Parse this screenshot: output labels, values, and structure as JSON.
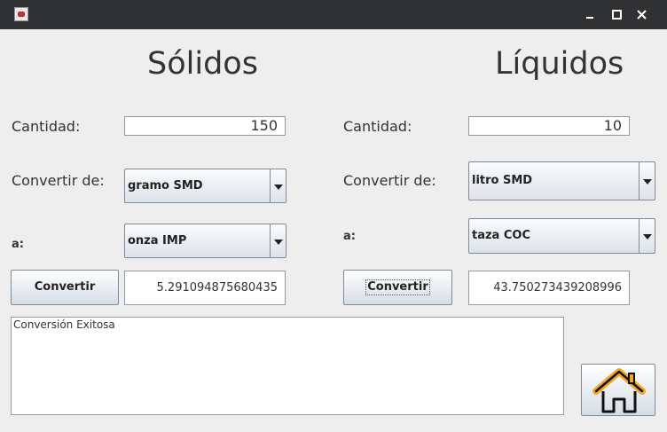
{
  "solidos": {
    "title": "Sólidos",
    "cantidad_label": "Cantidad:",
    "cantidad_value": "150",
    "de_label": "Convertir de:",
    "de_value": "gramo SMD",
    "a_label": "a:",
    "a_value": "onza IMP",
    "button_label": "Convertir",
    "result": "5.291094875680435"
  },
  "liquidos": {
    "title": "Líquidos",
    "cantidad_label": "Cantidad:",
    "cantidad_value": "10",
    "de_label": "Convertir de:",
    "de_value": "litro SMD",
    "a_label": "a:",
    "a_value": "taza COC",
    "button_label": "Convertir",
    "result": "43.750273439208996"
  },
  "message": "Conversión Exitosa",
  "icons": {
    "app": "java-app-icon",
    "home": "home-icon",
    "minimize": "minimize-icon",
    "maximize": "maximize-icon",
    "close": "close-icon"
  },
  "colors": {
    "titlebar": "#2f3133",
    "background": "#eeeeee",
    "home_icon": "#f5a623"
  }
}
